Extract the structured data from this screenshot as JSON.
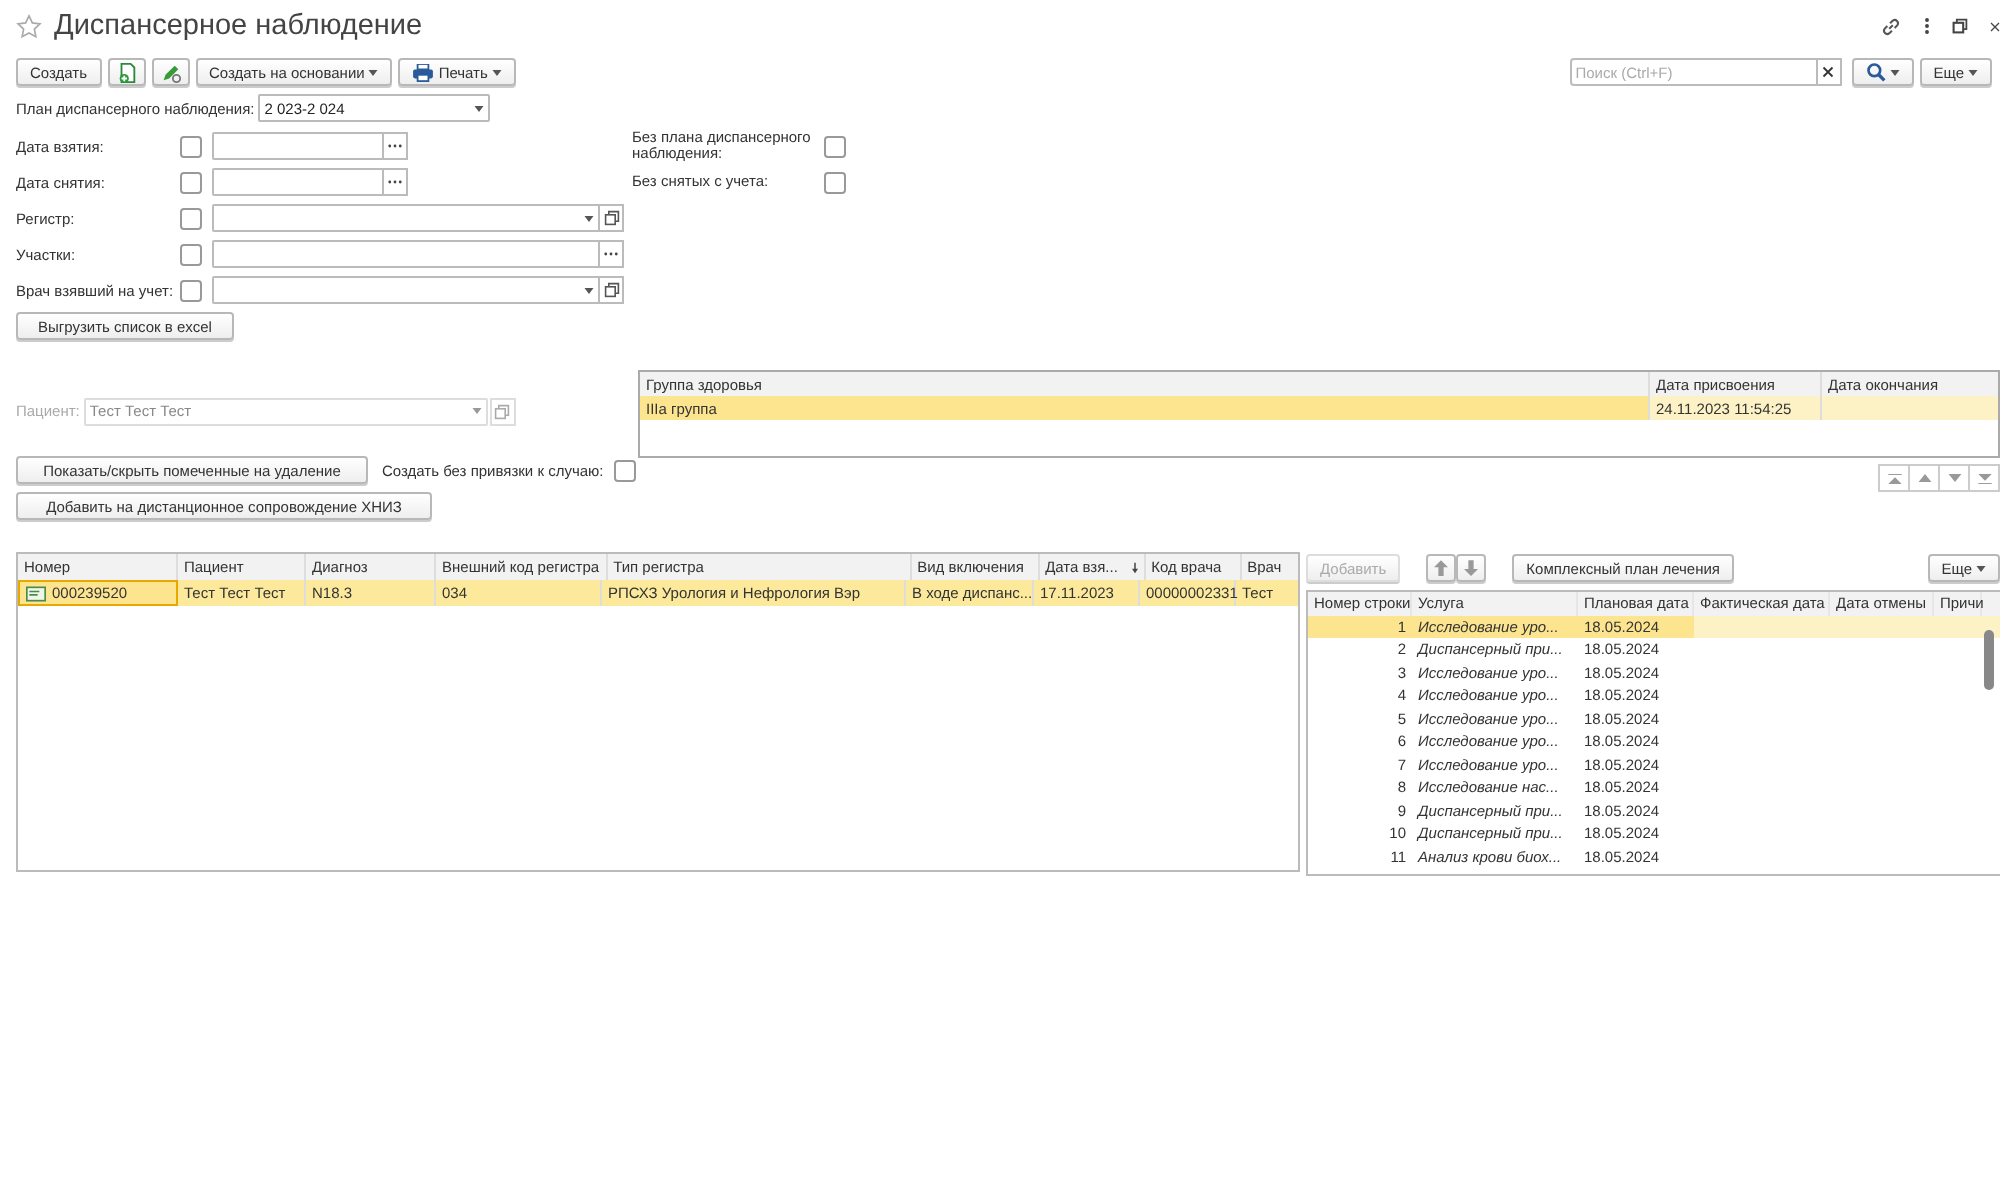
{
  "title": "Диспансерное наблюдение",
  "toolbar": [
    {
      "kind": "text",
      "label": "Создать"
    },
    {
      "kind": "add"
    },
    {
      "kind": "edit"
    },
    {
      "kind": "menu",
      "label": "Создать на основании"
    },
    {
      "kind": "print",
      "label": "Печать"
    }
  ],
  "search": {
    "placeholder": "Поиск (Ctrl+F)"
  },
  "more_button": "Еще",
  "plan": {
    "label": "План диспансерного наблюдения:",
    "value": "2 023-2 024"
  },
  "filters": [
    {
      "kind": "date",
      "label": "Дата взятия:",
      "checked": false
    },
    {
      "kind": "date",
      "label": "Дата снятия:",
      "checked": false
    },
    {
      "kind": "select",
      "label": "Регистр:",
      "checked": false
    },
    {
      "kind": "choice",
      "label": "Участки:",
      "checked": false
    },
    {
      "kind": "select",
      "label": "Врач взявший на учет:",
      "checked": false
    }
  ],
  "side_options": [
    {
      "label": "Без плана диспансерного наблюдения:",
      "checked": false
    },
    {
      "label": "Без снятых с учета:",
      "checked": false
    }
  ],
  "export_button": "Выгрузить список в excel",
  "patient": {
    "label": "Пациент:",
    "value": "Тест Тест Тест",
    "disabled": true
  },
  "toggle_deleted_button": "Показать/скрыть помеченные на удаление",
  "no_case_option": {
    "label": "Создать без привязки к случаю:",
    "checked": false
  },
  "remote_button": "Добавить на дистанционное сопровождение ХНИЗ",
  "health_table": {
    "columns": [
      "Группа здоровья",
      "Дата присвоения",
      "Дата окончания"
    ],
    "rows": [
      {
        "cells": [
          "IIIа группа",
          "24.11.2023 11:54:25",
          ""
        ],
        "selected": true
      }
    ]
  },
  "main_table": {
    "columns": [
      {
        "label": "Номер",
        "sorted": false
      },
      {
        "label": "Пациент",
        "sorted": false
      },
      {
        "label": "Диагноз",
        "sorted": false
      },
      {
        "label": "Внешний код регистра",
        "sorted": false
      },
      {
        "label": "Тип регистра",
        "sorted": false
      },
      {
        "label": "Вид включения",
        "sorted": false
      },
      {
        "label": "Дата взя...",
        "sorted": true
      },
      {
        "label": "Код врача",
        "sorted": false
      },
      {
        "label": "Врач",
        "sorted": false
      }
    ],
    "rows": [
      {
        "cells": [
          "000239520",
          "Тест Тест Тест",
          "N18.3",
          "034",
          "РПСХЗ Урология и Нефрология Вэр",
          "В ходе диспанс...",
          "17.11.2023",
          "00000002331",
          "Тест"
        ],
        "selected": true
      }
    ]
  },
  "services": {
    "add_button": {
      "label": "Добавить",
      "disabled": true
    },
    "plan_button": "Комплексный план лечения",
    "more_button": "Еще",
    "columns": [
      "Номер строки",
      "Услуга",
      "Плановая дата",
      "Фактическая дата",
      "Дата отмены",
      "Причи"
    ],
    "rows": [
      {
        "cells": [
          "1",
          "Исследование уро...",
          "18.05.2024"
        ],
        "selected": true
      },
      {
        "cells": [
          "2",
          "Диспансерный при...",
          "18.05.2024"
        ],
        "selected": false
      },
      {
        "cells": [
          "3",
          "Исследование уро...",
          "18.05.2024"
        ],
        "selected": false
      },
      {
        "cells": [
          "4",
          "Исследование уро...",
          "18.05.2024"
        ],
        "selected": false
      },
      {
        "cells": [
          "5",
          "Исследование уро...",
          "18.05.2024"
        ],
        "selected": false
      },
      {
        "cells": [
          "6",
          "Исследование уро...",
          "18.05.2024"
        ],
        "selected": false
      },
      {
        "cells": [
          "7",
          "Исследование уро...",
          "18.05.2024"
        ],
        "selected": false
      },
      {
        "cells": [
          "8",
          "Исследование нас...",
          "18.05.2024"
        ],
        "selected": false
      },
      {
        "cells": [
          "9",
          "Диспансерный при...",
          "18.05.2024"
        ],
        "selected": false
      },
      {
        "cells": [
          "10",
          "Диспансерный при...",
          "18.05.2024"
        ],
        "selected": false
      },
      {
        "cells": [
          "11",
          "Анализ крови биох...",
          "18.05.2024"
        ],
        "selected": false
      }
    ]
  }
}
